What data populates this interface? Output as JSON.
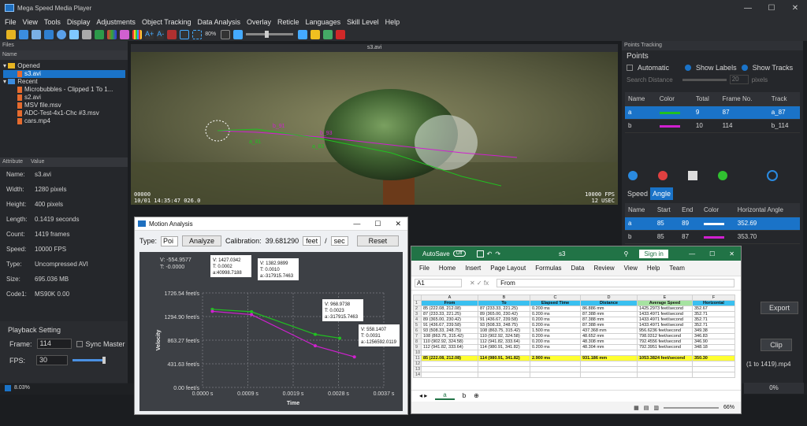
{
  "app": {
    "title": "Mega Speed Media Player",
    "zoom": "80%",
    "status_left": "8.03%",
    "status_right": "0%"
  },
  "menu": [
    "File",
    "View",
    "Tools",
    "Display",
    "Adjustments",
    "Object Tracking",
    "Data Analysis",
    "Overlay",
    "Reticle",
    "Languages",
    "Skill Level",
    "Help"
  ],
  "files": {
    "title": "Files",
    "col": "Name",
    "opened": "Opened",
    "opened_items": [
      "s3.avi"
    ],
    "recent": "Recent",
    "recent_items": [
      "Microbubbles - Clipped 1 To 1...",
      "s2.avi",
      "MSV file.msv",
      "ADC-Test-4x1-Chc #3.msv",
      "cars.mp4"
    ]
  },
  "attributes": {
    "col1": "Attribute",
    "col2": "Value",
    "rows": [
      [
        "Name:",
        "s3.avi"
      ],
      [
        "Width:",
        "1280 pixels"
      ],
      [
        "Height:",
        "400 pixels"
      ],
      [
        "Length:",
        "0.1419 seconds"
      ],
      [
        "Count:",
        "1419 frames"
      ],
      [
        "Speed:",
        "10000 FPS"
      ],
      [
        "Type:",
        "Uncompressed AVI"
      ],
      [
        "Size:",
        "695.036 MB"
      ],
      [
        "Code1:",
        "MS90K 0.00"
      ]
    ]
  },
  "playback": {
    "title": "Playback Setting",
    "frame_label": "Frame:",
    "frame": "114",
    "sync": "Sync Master",
    "fps_label": "FPS:",
    "fps": "30"
  },
  "video": {
    "title": "s3.avi",
    "ts_left1": "00000",
    "ts_left2": "10/01 14:35:47 026.0",
    "ts_right1": "10000 FPS",
    "ts_right2": "12 USEC",
    "labels": [
      "b_91",
      "b_93",
      "a_81",
      "a_83"
    ]
  },
  "points": {
    "title": "Points Tracking",
    "section": "Points",
    "auto": "Automatic",
    "show_labels": "Show Labels",
    "show_tracks": "Show Tracks",
    "search": "Search Distance",
    "search_val": "20",
    "unit": "pixels",
    "cols": [
      "Name",
      "Color",
      "Total",
      "Frame No.",
      "Track"
    ],
    "rows": [
      {
        "name": "a",
        "color": "#20c020",
        "total": "9",
        "frame": "87",
        "track": "a_87"
      },
      {
        "name": "b",
        "color": "#d020d0",
        "total": "10",
        "frame": "114",
        "track": "b_114"
      }
    ]
  },
  "angle": {
    "tabs": [
      "Speed",
      "Angle"
    ],
    "cols": [
      "Name",
      "Start",
      "End",
      "Color",
      "Horizontal Angle"
    ],
    "rows": [
      {
        "name": "a",
        "start": "85",
        "end": "89",
        "color": "#ffffff",
        "angle": "352.69"
      },
      {
        "name": "b",
        "start": "85",
        "end": "87",
        "color": "#d020d0",
        "angle": "353.70"
      }
    ],
    "export": "Export",
    "clip": "Clip",
    "clip_file": "(1 to 1419).mp4"
  },
  "motion": {
    "title": "Motion Analysis",
    "type_label": "Type:",
    "type_val": "Poi",
    "analyze": "Analyze",
    "calib_label": "Calibration:",
    "calib": "39.681290",
    "unit1": "feet",
    "per": "/",
    "unit2": "sec",
    "reset": "Reset",
    "v_readout": "V: -554.9577",
    "t_readout": "T: -0.0000",
    "legend": [
      "a",
      "b"
    ],
    "ylabel": "Velocity",
    "xlabel": "Time",
    "yticks": [
      "1726.54 feet/s",
      "1294.90 feet/s",
      "863.27 feet/s",
      "431.63 feet/s",
      "0.00 feet/s"
    ],
    "xticks": [
      "0.0000 s",
      "0.0009 s",
      "0.0019 s",
      "0.0028 s",
      "0.0037 s"
    ],
    "tips": [
      [
        "V: 1427.0342",
        "T: 0.0002",
        "a:40998.7188"
      ],
      [
        "V: 1382.9899",
        "T: 0.0010",
        "a:-317915.7463"
      ],
      [
        "V: 968.9738",
        "T: 0.0023",
        "a:-317915.7463"
      ],
      [
        "V: 558.1407",
        "T: 0.0031",
        "a:-1256592.0119"
      ]
    ]
  },
  "chart_data": {
    "type": "line",
    "xlabel": "Time",
    "ylabel": "Velocity",
    "xlim": [
      0,
      0.0037
    ],
    "ylim": [
      0,
      1726.54
    ],
    "series": [
      {
        "name": "a",
        "x": [
          0.0002,
          0.001,
          0.0023,
          0.0028
        ],
        "y": [
          1427,
          1383,
          969,
          900
        ]
      },
      {
        "name": "b",
        "x": [
          0.0002,
          0.001,
          0.0023,
          0.0031
        ],
        "y": [
          1390,
          1330,
          760,
          558
        ]
      }
    ]
  },
  "excel": {
    "autosave": "AutoSave",
    "off": "Off",
    "file": "s3",
    "signin": "Sign in",
    "tabs": [
      "File",
      "Home",
      "Insert",
      "Page Layout",
      "Formulas",
      "Data",
      "Review",
      "View",
      "Help",
      "Team"
    ],
    "namebox": "A1",
    "formula": "From",
    "cols": [
      "A",
      "B",
      "C",
      "D",
      "E",
      "F"
    ],
    "headers": [
      "From",
      "To",
      "Elapsed Time",
      "Distance",
      "Average Speed",
      "Horizontal"
    ],
    "rows": [
      [
        "85 (222.08, 212.08)",
        "87 (233.33, 221.25)",
        "0.200 ms",
        "86.886 mm",
        "1425.2973 feet/second",
        "352.67"
      ],
      [
        "87 (233.33, 221.25)",
        "89 (365.00, 230.42)",
        "0.200 ms",
        "87.388 mm",
        "1433.4971 feet/second",
        "352.71"
      ],
      [
        "89 (365.00, 230.42)",
        "91 (436.67, 239.58)",
        "0.200 ms",
        "87.388 mm",
        "1433.4971 feet/second",
        "352.71"
      ],
      [
        "91 (436.67, 239.58)",
        "93 (508.33, 248.75)",
        "0.200 ms",
        "87.388 mm",
        "1433.4971 feet/second",
        "352.71"
      ],
      [
        "93 (508.33, 248.75)",
        "108 (863.75, 315.42)",
        "1.500 ms",
        "437.368 mm",
        "956.6236 feet/second",
        "349.38"
      ],
      [
        "108 (863.75, 315.42)",
        "110 (902.92, 324.58)",
        "0.200 ms",
        "48.652 mm",
        "798.0312 feet/second",
        "346.83"
      ],
      [
        "110 (902.92, 324.58)",
        "112 (941.82, 333.64)",
        "0.200 ms",
        "48.308 mm",
        "792.4556 feet/second",
        "346.90"
      ],
      [
        "112 (941.82, 333.64)",
        "114 (980.91, 341.82)",
        "0.200 ms",
        "48.304 mm",
        "792.3951 feet/second",
        "348.18"
      ]
    ],
    "total": [
      "85 (222.08, 212.08)",
      "114 (980.91, 341.82)",
      "2.900 ms",
      "931.186 mm",
      "1053.3824 feet/second",
      "350.30"
    ],
    "sheets": [
      "a",
      "b"
    ],
    "zoom": "66%"
  }
}
